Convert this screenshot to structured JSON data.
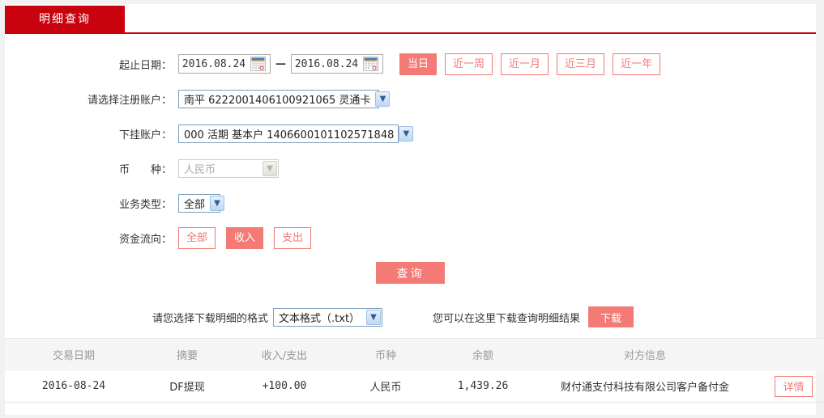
{
  "colors": {
    "brand_red": "#c8030d",
    "accent_salmon": "#f47a76",
    "amount_income": "#e60000"
  },
  "tab": {
    "label": "明细查询"
  },
  "form": {
    "date_range": {
      "label": "起止日期：",
      "start_value": "2016.08.24",
      "end_value": "2016.08.24",
      "separator": "—"
    },
    "quick_buttons": [
      {
        "label": "当日",
        "active": true
      },
      {
        "label": "近一周",
        "active": false
      },
      {
        "label": "近一月",
        "active": false
      },
      {
        "label": "近三月",
        "active": false
      },
      {
        "label": "近一年",
        "active": false
      }
    ],
    "register_account": {
      "label": "请选择注册账户：",
      "value": "南平 6222001406100921065 灵通卡"
    },
    "sub_account": {
      "label": "下挂账户：",
      "value": "000 活期 基本户 1406600101102571848"
    },
    "currency": {
      "label": "币　　种：",
      "value": "人民币",
      "disabled": true
    },
    "business_type": {
      "label": "业务类型：",
      "value": "全部"
    },
    "fund_flow": {
      "label": "资金流向：",
      "options": [
        {
          "label": "全部",
          "active": false
        },
        {
          "label": "收入",
          "active": true
        },
        {
          "label": "支出",
          "active": false
        }
      ]
    },
    "query_button": "查询"
  },
  "download": {
    "format_label": "请您选择下载明细的格式",
    "format_value": "文本格式（.txt）",
    "hint": "您可以在这里下载查询明细结果",
    "button": "下载"
  },
  "table": {
    "headers": {
      "date": "交易日期",
      "summary": "摘要",
      "amount": "收入/支出",
      "currency": "币种",
      "balance": "余额",
      "counterparty": "对方信息",
      "action": ""
    },
    "rows": [
      {
        "date": "2016-08-24",
        "summary": "DF提现",
        "amount": "+100.00",
        "currency": "人民币",
        "balance": "1,439.26",
        "counterparty": "财付通支付科技有限公司客户备付金",
        "action": "详情"
      }
    ]
  }
}
